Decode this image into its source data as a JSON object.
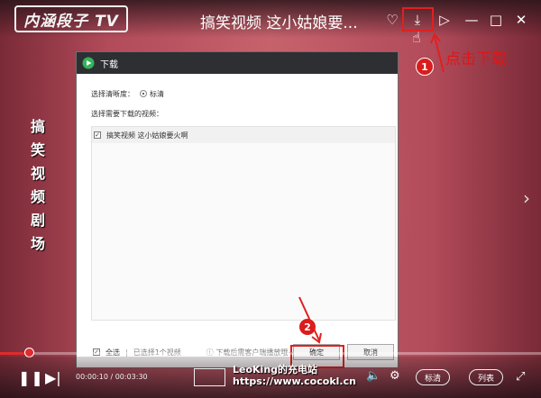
{
  "player": {
    "logo_text": "内涵段子 TV",
    "title": "搞笑视频 这小姑娘要...",
    "vertical_text": [
      "搞",
      "笑",
      "视",
      "频",
      "剧",
      "场"
    ],
    "controls": [
      {
        "name": "favorite-icon",
        "glyph": "♡"
      },
      {
        "name": "download-icon",
        "glyph": "⤓"
      },
      {
        "name": "share-icon",
        "glyph": "▷"
      },
      {
        "name": "minimize-icon",
        "glyph": "—"
      },
      {
        "name": "maximize-icon",
        "glyph": "□"
      },
      {
        "name": "close-icon",
        "glyph": "✕"
      }
    ]
  },
  "annotations": {
    "step1_badge": "1",
    "step1_text": "点击下载",
    "step2_badge": "2"
  },
  "dialog": {
    "title": "下载",
    "quality_label": "选择清晰度：",
    "quality_option": "标清",
    "select_label": "选择需要下载的视频：",
    "items": [
      {
        "checked": true,
        "label": "搞笑视频 这小姑娘要火啊"
      }
    ],
    "select_all_label": "全选",
    "selected_count": "已选择1个视频",
    "notice": "下载后需客户端播放哦~",
    "confirm_label": "确定",
    "cancel_label": "取消"
  },
  "bottom_bar": {
    "progress": 0.05,
    "time": "00:00:10 / 00:03:30",
    "quality_button": "标清",
    "playlist_button": "列表",
    "watermark_line1": "LeoKing的充电站",
    "watermark_line2": "https://www.cocokl.cn"
  },
  "colors": {
    "accent_red": "#e02020",
    "dialog_header": "#2e2f33"
  }
}
